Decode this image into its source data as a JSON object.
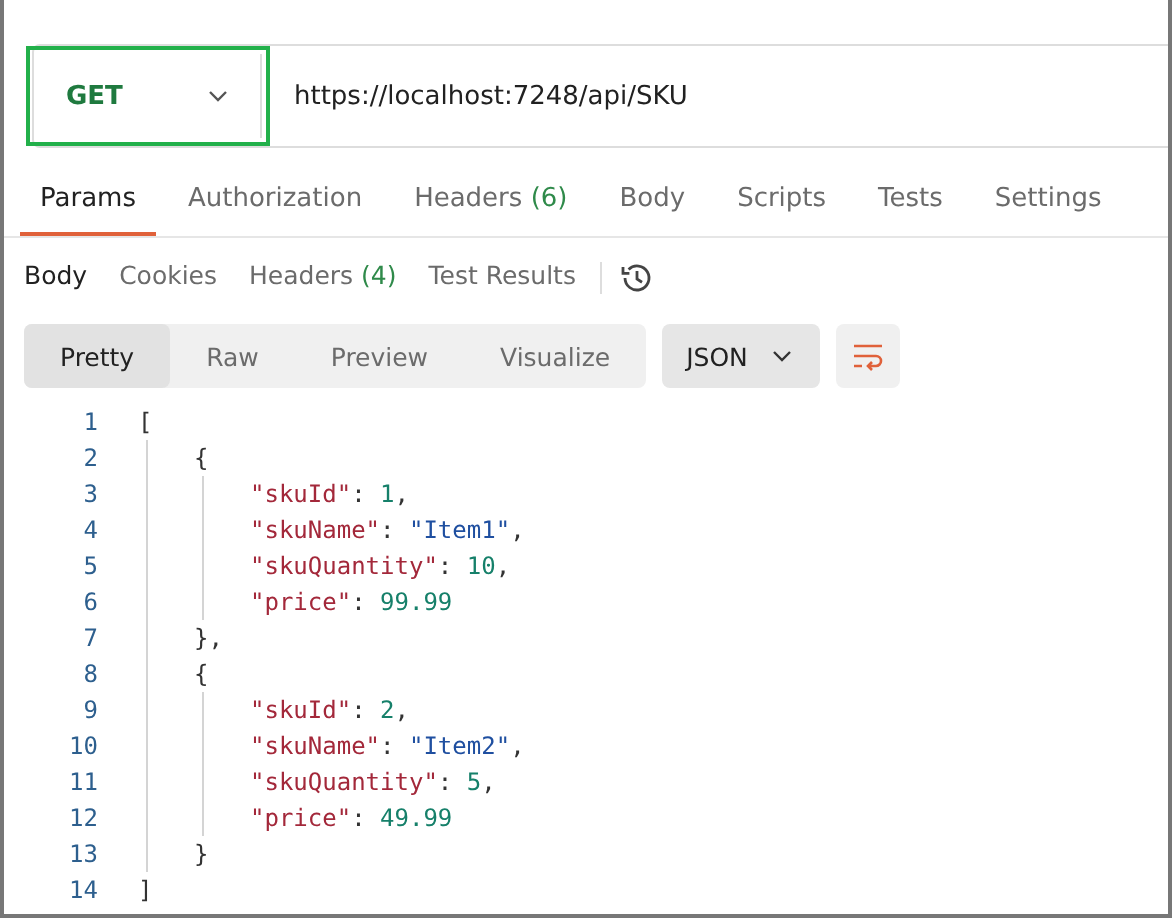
{
  "request": {
    "method": "GET",
    "url": "https://localhost:7248/api/SKU",
    "highlighted": true
  },
  "request_tabs": [
    {
      "label": "Params",
      "selected": true
    },
    {
      "label": "Authorization",
      "selected": false
    },
    {
      "label": "Headers",
      "count": "(6)",
      "selected": false
    },
    {
      "label": "Body",
      "selected": false
    },
    {
      "label": "Scripts",
      "selected": false
    },
    {
      "label": "Tests",
      "selected": false
    },
    {
      "label": "Settings",
      "selected": false
    }
  ],
  "response_tabs": [
    {
      "label": "Body",
      "selected": true
    },
    {
      "label": "Cookies",
      "selected": false
    },
    {
      "label": "Headers",
      "count": "(4)",
      "selected": false
    },
    {
      "label": "Test Results",
      "selected": false
    }
  ],
  "view_modes": [
    {
      "label": "Pretty",
      "selected": true
    },
    {
      "label": "Raw",
      "selected": false
    },
    {
      "label": "Preview",
      "selected": false
    },
    {
      "label": "Visualize",
      "selected": false
    }
  ],
  "format": "JSON",
  "code": [
    {
      "number": "1",
      "tokens": [
        {
          "kind": "punct",
          "text": "["
        }
      ],
      "children": [
        {
          "number": "2",
          "tokens": [
            {
              "kind": "punct",
              "text": "{"
            }
          ],
          "children": [
            {
              "number": "3",
              "tokens": [
                {
                  "kind": "key",
                  "text": "\"skuId\""
                },
                {
                  "kind": "punct",
                  "text": ": "
                },
                {
                  "kind": "number",
                  "text": "1"
                },
                {
                  "kind": "punct",
                  "text": ","
                }
              ]
            },
            {
              "number": "4",
              "tokens": [
                {
                  "kind": "key",
                  "text": "\"skuName\""
                },
                {
                  "kind": "punct",
                  "text": ": "
                },
                {
                  "kind": "string",
                  "text": "\"Item1\""
                },
                {
                  "kind": "punct",
                  "text": ","
                }
              ]
            },
            {
              "number": "5",
              "tokens": [
                {
                  "kind": "key",
                  "text": "\"skuQuantity\""
                },
                {
                  "kind": "punct",
                  "text": ": "
                },
                {
                  "kind": "number",
                  "text": "10"
                },
                {
                  "kind": "punct",
                  "text": ","
                }
              ]
            },
            {
              "number": "6",
              "tokens": [
                {
                  "kind": "key",
                  "text": "\"price\""
                },
                {
                  "kind": "punct",
                  "text": ": "
                },
                {
                  "kind": "number",
                  "text": "99.99"
                }
              ]
            }
          ]
        },
        {
          "number": "7",
          "tokens": [
            {
              "kind": "punct",
              "text": "},"
            }
          ]
        },
        {
          "number": "8",
          "tokens": [
            {
              "kind": "punct",
              "text": "{"
            }
          ],
          "children": [
            {
              "number": "9",
              "tokens": [
                {
                  "kind": "key",
                  "text": "\"skuId\""
                },
                {
                  "kind": "punct",
                  "text": ": "
                },
                {
                  "kind": "number",
                  "text": "2"
                },
                {
                  "kind": "punct",
                  "text": ","
                }
              ]
            },
            {
              "number": "10",
              "tokens": [
                {
                  "kind": "key",
                  "text": "\"skuName\""
                },
                {
                  "kind": "punct",
                  "text": ": "
                },
                {
                  "kind": "string",
                  "text": "\"Item2\""
                },
                {
                  "kind": "punct",
                  "text": ","
                }
              ]
            },
            {
              "number": "11",
              "tokens": [
                {
                  "kind": "key",
                  "text": "\"skuQuantity\""
                },
                {
                  "kind": "punct",
                  "text": ": "
                },
                {
                  "kind": "number",
                  "text": "5"
                },
                {
                  "kind": "punct",
                  "text": ","
                }
              ]
            },
            {
              "number": "12",
              "tokens": [
                {
                  "kind": "key",
                  "text": "\"price\""
                },
                {
                  "kind": "punct",
                  "text": ": "
                },
                {
                  "kind": "number",
                  "text": "49.99"
                }
              ]
            }
          ]
        },
        {
          "number": "13",
          "tokens": [
            {
              "kind": "punct",
              "text": "}"
            }
          ]
        }
      ]
    },
    {
      "number": "14",
      "tokens": [
        {
          "kind": "punct",
          "text": "]"
        }
      ]
    }
  ]
}
